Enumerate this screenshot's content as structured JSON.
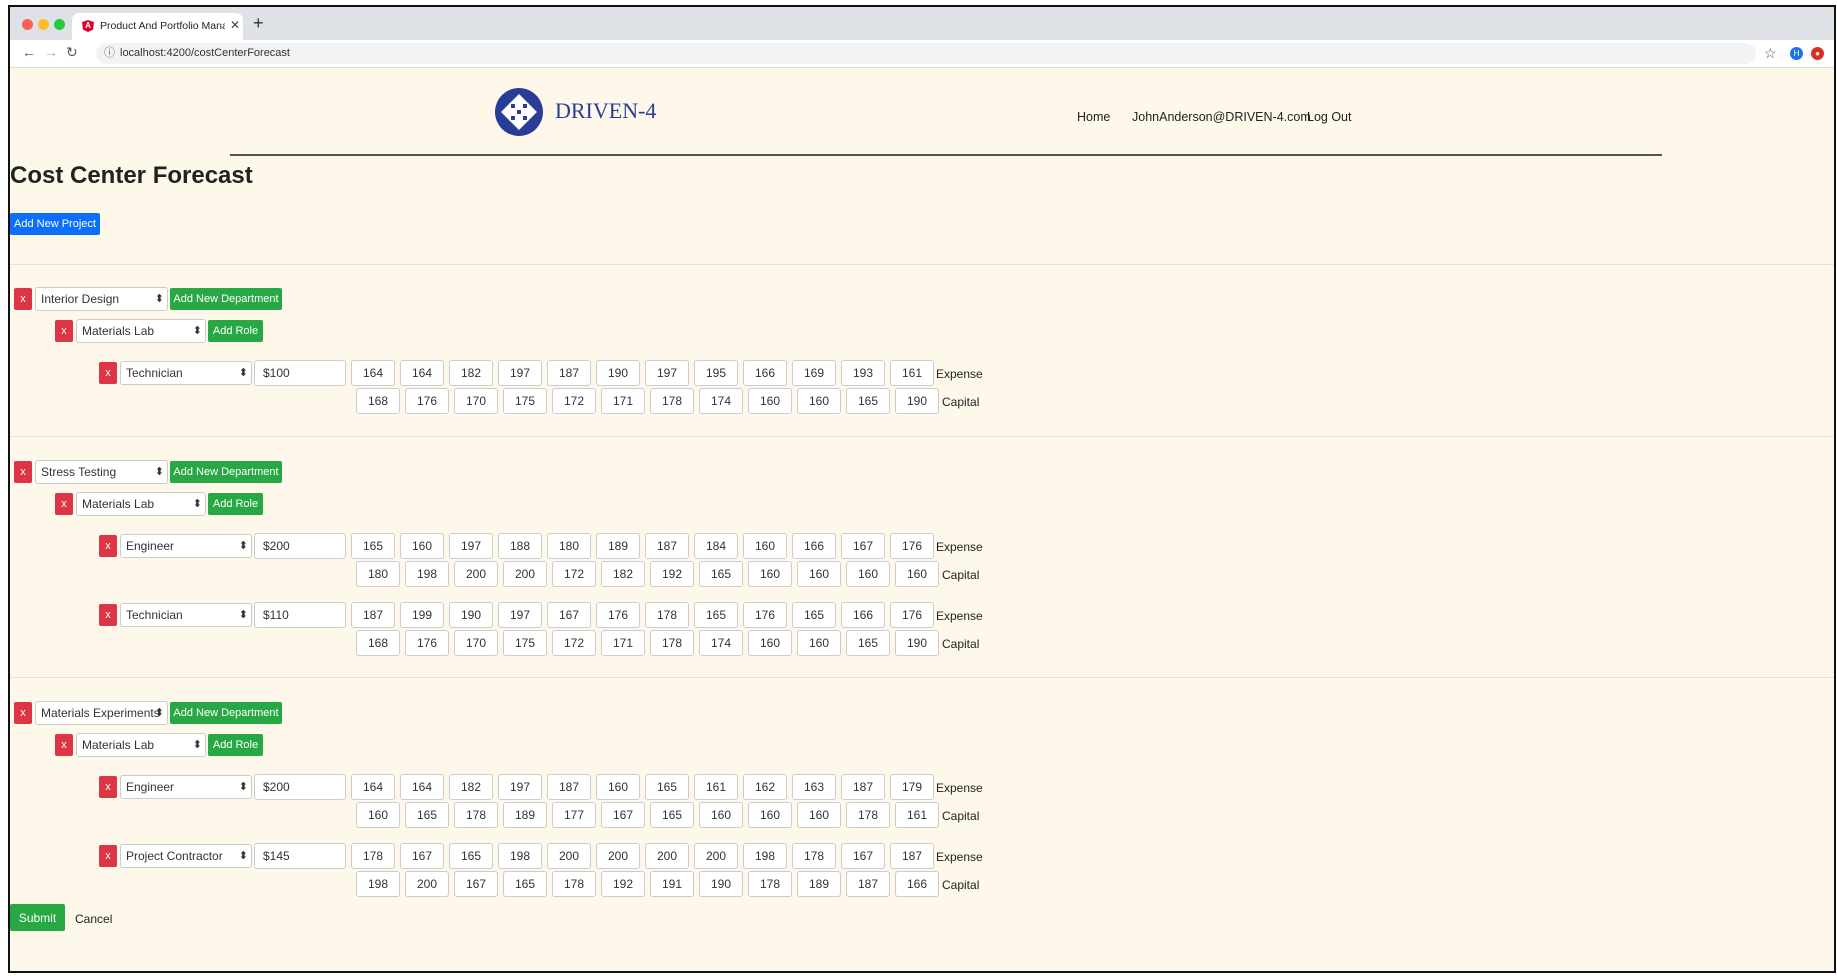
{
  "browser": {
    "tab_title": "Product And Portfolio Manager",
    "url": "localhost:4200/costCenterForecast"
  },
  "header": {
    "logo_text": "DRIVEN-4",
    "nav": [
      "Home",
      "JohnAnderson@DRIVEN-4.com",
      "Log Out"
    ]
  },
  "page": {
    "title": "Cost Center Forecast",
    "add_project_label": "Add New Project",
    "remove_label": "x",
    "add_department_label": "Add New Department",
    "add_role_label": "Add Role",
    "expense_label": "Expense",
    "capital_label": "Capital",
    "submit_label": "Submit",
    "cancel_label": "Cancel"
  },
  "projects": [
    {
      "name": "Interior Design",
      "department": "Materials Lab",
      "roles": [
        {
          "role": "Technician",
          "rate": "$100",
          "expense": [
            "164",
            "164",
            "182",
            "197",
            "187",
            "190",
            "197",
            "195",
            "166",
            "169",
            "193",
            "161"
          ],
          "capital": [
            "168",
            "176",
            "170",
            "175",
            "172",
            "171",
            "178",
            "174",
            "160",
            "160",
            "165",
            "190"
          ]
        }
      ]
    },
    {
      "name": "Stress Testing",
      "department": "Materials Lab",
      "roles": [
        {
          "role": "Engineer",
          "rate": "$200",
          "expense": [
            "165",
            "160",
            "197",
            "188",
            "180",
            "189",
            "187",
            "184",
            "160",
            "166",
            "167",
            "176"
          ],
          "capital": [
            "180",
            "198",
            "200",
            "200",
            "172",
            "182",
            "192",
            "165",
            "160",
            "160",
            "160",
            "160"
          ]
        },
        {
          "role": "Technician",
          "rate": "$110",
          "expense": [
            "187",
            "199",
            "190",
            "197",
            "167",
            "176",
            "178",
            "165",
            "176",
            "165",
            "166",
            "176"
          ],
          "capital": [
            "168",
            "176",
            "170",
            "175",
            "172",
            "171",
            "178",
            "174",
            "160",
            "160",
            "165",
            "190"
          ]
        }
      ]
    },
    {
      "name": "Materials Experiments",
      "department": "Materials Lab",
      "roles": [
        {
          "role": "Engineer",
          "rate": "$200",
          "expense": [
            "164",
            "164",
            "182",
            "197",
            "187",
            "160",
            "165",
            "161",
            "162",
            "163",
            "187",
            "179"
          ],
          "capital": [
            "160",
            "165",
            "178",
            "189",
            "177",
            "167",
            "165",
            "160",
            "160",
            "160",
            "178",
            "161"
          ]
        },
        {
          "role": "Project Contractor",
          "rate": "$145",
          "expense": [
            "178",
            "167",
            "165",
            "198",
            "200",
            "200",
            "200",
            "200",
            "198",
            "178",
            "167",
            "187"
          ],
          "capital": [
            "198",
            "200",
            "167",
            "165",
            "178",
            "192",
            "191",
            "190",
            "178",
            "189",
            "187",
            "166"
          ]
        }
      ]
    }
  ],
  "colors": {
    "primary": "#0d6efd",
    "success": "#28a745",
    "danger": "#dc3545",
    "page_bg": "#fdf8ea"
  }
}
